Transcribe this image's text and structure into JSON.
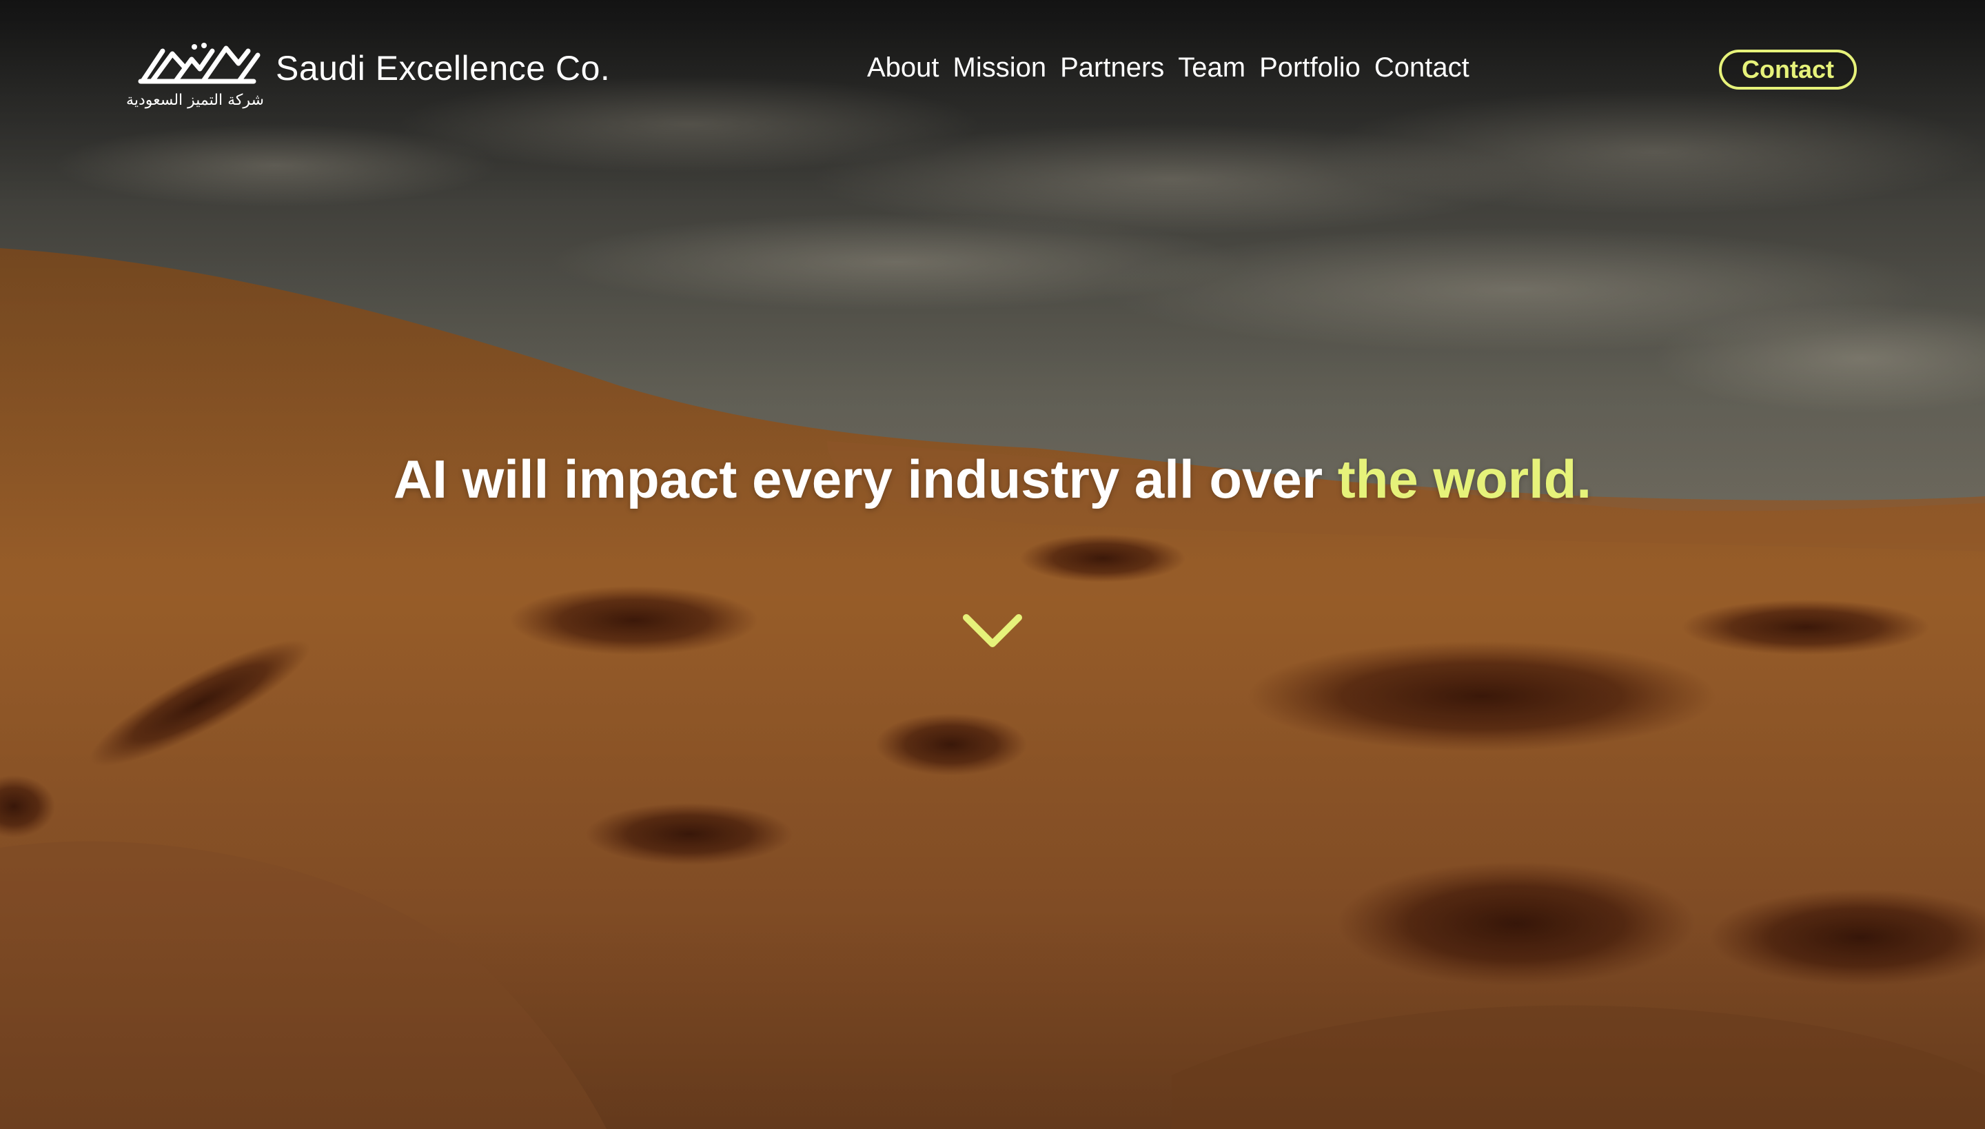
{
  "brand": {
    "name": "Saudi Excellence Co.",
    "logo_arabic": "شركة التميز السعودية"
  },
  "nav": {
    "items": [
      {
        "label": "About"
      },
      {
        "label": "Mission"
      },
      {
        "label": "Partners"
      },
      {
        "label": "Team"
      },
      {
        "label": "Portfolio"
      },
      {
        "label": "Contact"
      }
    ],
    "cta_label": "Contact"
  },
  "hero": {
    "headline_main": "AI will impact every industry all over ",
    "headline_accent": "the world."
  },
  "icons": {
    "logo": "brand-logo-icon",
    "scroll": "chevron-down-icon"
  },
  "colors": {
    "accent": "#e6f27a",
    "text": "#ffffff"
  }
}
